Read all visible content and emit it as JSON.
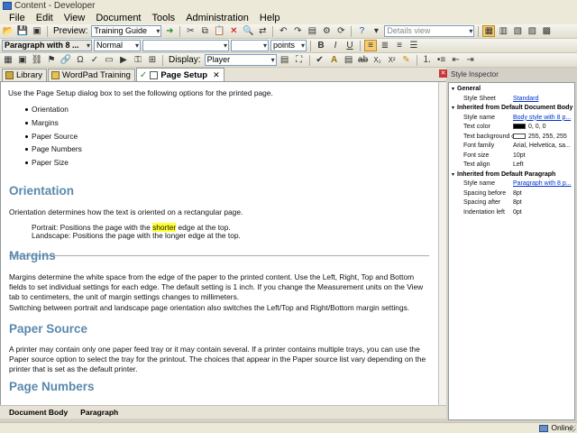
{
  "window": {
    "title": "Content - Developer"
  },
  "menu": [
    "File",
    "Edit",
    "View",
    "Document",
    "Tools",
    "Administration",
    "Help"
  ],
  "toolbar1": {
    "preview_label": "Preview:",
    "preview_value": "Training Guide",
    "view_value": "Details view"
  },
  "toolbar2": {
    "style_value": "Paragraph with 8 ...",
    "font_value": "Normal",
    "unit_value": "points"
  },
  "toolbar3": {
    "display_label": "Display:",
    "display_value": "Player"
  },
  "tabs": [
    "Library",
    "WordPad Training",
    "Page Setup"
  ],
  "doc": {
    "intro": "Use the Page Setup dialog box to set the following options for the printed page.",
    "bullets": [
      "Orientation",
      "Margins",
      "Paper Source",
      "Page Numbers",
      "Paper Size"
    ],
    "sections": [
      {
        "heading": "Orientation",
        "paras": [
          "Orientation determines how the text is oriented on a rectangular page."
        ],
        "ex1_pre": "Portrait: Positions the page with the ",
        "ex1_hl": "shorter",
        "ex1_post": " edge at the top.",
        "ex2": "Landscape: Positions the page with the longer edge at the top."
      },
      {
        "heading": "Margins",
        "paras": [
          "Margins determine the white space from the edge of the paper to the printed content. Use the Left, Right, Top and Bottom fields to set individual settings for each edge. The default setting is 1 inch. If you change the Measurement units on the View tab to centimeters, the unit of margin settings changes to millimeters.",
          "Switching between portrait and landscape page orientation also switches the Left/Top and Right/Bottom margin settings."
        ]
      },
      {
        "heading": "Paper Source",
        "paras": [
          "A printer may contain only one paper feed tray or it may contain several. If a printer contains multiple trays, you can use the Paper source option to select the tray for the printout. The choices that appear in the Paper source list vary depending on the printer that is set as the default printer."
        ]
      },
      {
        "heading": "Page Numbers"
      }
    ]
  },
  "status": {
    "left1": "Document Body",
    "left2": "Paragraph",
    "right": "Online"
  },
  "inspector": {
    "title": "Style Inspector",
    "general": {
      "header": "General",
      "rows": [
        {
          "k": "Style Sheet",
          "v": "Standard"
        }
      ]
    },
    "doc_body": {
      "header": "Inherited from Default Document Body",
      "rows": [
        {
          "k": "Style name",
          "v": "Body style with 8 p..."
        },
        {
          "k": "Text color",
          "v": "0, 0, 0",
          "color": "#000000"
        },
        {
          "k": "Text background c",
          "v": "255, 255, 255",
          "color": "#ffffff"
        },
        {
          "k": "Font family",
          "v": "Arial, Helvetica, sa..."
        },
        {
          "k": "Font size",
          "v": "10pt"
        },
        {
          "k": "Text align",
          "v": "Left"
        }
      ]
    },
    "default_para": {
      "header": "Inherited from Default Paragraph",
      "rows": [
        {
          "k": "Style name",
          "v": "Paragraph with 8 p..."
        },
        {
          "k": "Spacing before",
          "v": "8pt"
        },
        {
          "k": "Spacing after",
          "v": "8pt"
        },
        {
          "k": "Indentation left",
          "v": "0pt"
        }
      ]
    }
  }
}
